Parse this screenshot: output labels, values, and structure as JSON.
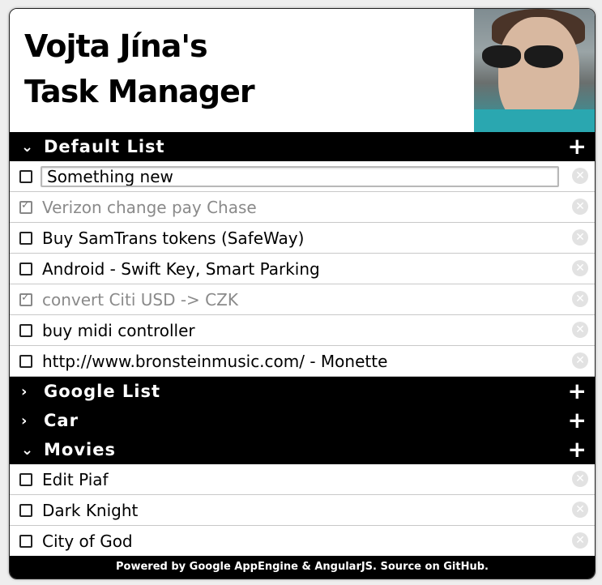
{
  "header": {
    "title_line1": "Vojta Jína's",
    "title_line2": "Task Manager"
  },
  "icons": {
    "expanded": "⌄",
    "collapsed": "›",
    "add": "+",
    "delete": "✕"
  },
  "lists": [
    {
      "name": "Default List",
      "expanded": true,
      "items": [
        {
          "text": "Something new",
          "done": false,
          "editing": true
        },
        {
          "text": "Verizon change pay Chase",
          "done": true
        },
        {
          "text": "Buy SamTrans tokens (SafeWay)",
          "done": false
        },
        {
          "text": "Android - Swift Key, Smart Parking",
          "done": false
        },
        {
          "text": "convert Citi USD -> CZK",
          "done": true
        },
        {
          "text": "buy midi controller",
          "done": false
        },
        {
          "text": "http://www.bronsteinmusic.com/ - Monette",
          "done": false
        }
      ]
    },
    {
      "name": "Google List",
      "expanded": false,
      "items": []
    },
    {
      "name": "Car",
      "expanded": false,
      "items": []
    },
    {
      "name": "Movies",
      "expanded": true,
      "items": [
        {
          "text": "Edit Piaf",
          "done": false
        },
        {
          "text": "Dark Knight",
          "done": false
        },
        {
          "text": "City of God",
          "done": false
        }
      ]
    }
  ],
  "footer": {
    "text": "Powered by Google AppEngine & AngularJS. Source on GitHub."
  }
}
